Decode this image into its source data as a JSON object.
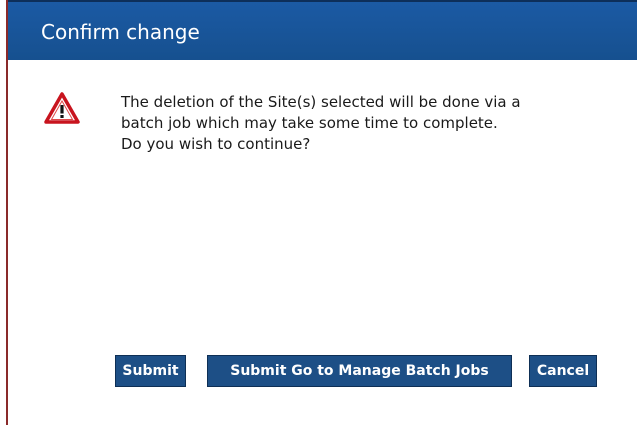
{
  "dialog": {
    "title": "Confirm change",
    "icon": "warning-icon",
    "message_lines": [
      "The deletion of the Site(s) selected will be done via a",
      "batch job which may take some time to complete.",
      "Do you wish to continue?"
    ],
    "buttons": {
      "submit": "Submit",
      "submit_batch": "Submit Go to Manage Batch Jobs",
      "cancel": "Cancel"
    }
  },
  "colors": {
    "title_bar": "#1b5aa4",
    "button": "#1d4f86",
    "warning_red": "#c8141e"
  }
}
